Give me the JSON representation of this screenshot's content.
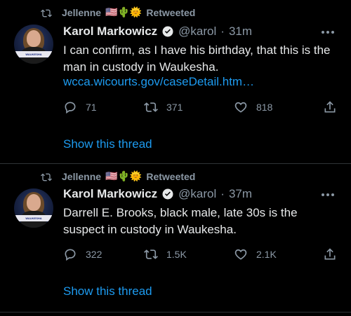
{
  "tweets": [
    {
      "retweeter": "Jellenne",
      "retweeter_emoji": "🇺🇸🌵🌞",
      "retweeted_label": "Retweeted",
      "author_name": "Karol Markowicz",
      "author_handle": "@karol",
      "separator": "·",
      "time": "31m",
      "text": "I can confirm, as I have his birthday, that this is the man in custody in Waukesha.",
      "link": "wcca.wicourts.gov/caseDetail.htm…",
      "reply_count": "71",
      "retweet_count": "371",
      "like_count": "818",
      "show_thread": "Show this thread"
    },
    {
      "retweeter": "Jellenne",
      "retweeter_emoji": "🇺🇸🌵🌞",
      "retweeted_label": "Retweeted",
      "author_name": "Karol Markowicz",
      "author_handle": "@karol",
      "separator": "·",
      "time": "37m",
      "text": "Darrell E. Brooks, black male, late 30s is the suspect in custody in Waukesha.",
      "reply_count": "322",
      "retweet_count": "1.5K",
      "like_count": "2.1K",
      "show_thread": "Show this thread"
    }
  ],
  "icons": {
    "retweet": "retweet-icon",
    "verified": "verified-badge-icon",
    "reply": "reply-icon",
    "like": "heart-icon",
    "share": "share-icon",
    "more": "more-options-icon"
  },
  "colors": {
    "background": "#000000",
    "text": "#e7e9ea",
    "muted": "#8b98a5",
    "accent": "#1d9bf0",
    "divider": "#2f3336"
  }
}
